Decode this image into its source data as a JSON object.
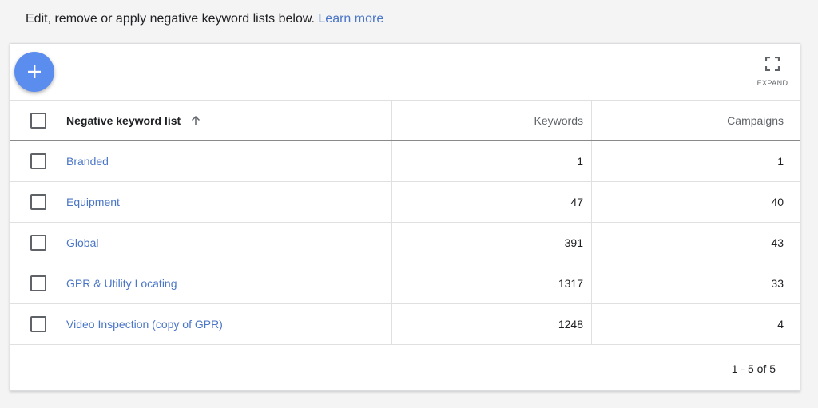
{
  "intro": {
    "text": "Edit, remove or apply negative keyword lists below.",
    "link": "Learn more"
  },
  "toolbar": {
    "add_icon": "plus-icon",
    "expand_icon": "fullscreen-icon",
    "expand_label": "EXPAND"
  },
  "table": {
    "columns": {
      "name": "Negative keyword list",
      "keywords": "Keywords",
      "campaigns": "Campaigns"
    },
    "sort_icon": "arrow-up-icon",
    "rows": [
      {
        "name": "Branded",
        "keywords": "1",
        "campaigns": "1"
      },
      {
        "name": "Equipment",
        "keywords": "47",
        "campaigns": "40"
      },
      {
        "name": "Global",
        "keywords": "391",
        "campaigns": "43"
      },
      {
        "name": "GPR & Utility Locating",
        "keywords": "1317",
        "campaigns": "33"
      },
      {
        "name": "Video Inspection (copy of GPR)",
        "keywords": "1248",
        "campaigns": "4"
      }
    ]
  },
  "pagination": {
    "text": "1 - 5 of 5"
  },
  "colors": {
    "accent": "#5b8def",
    "link": "#4a76c7"
  }
}
